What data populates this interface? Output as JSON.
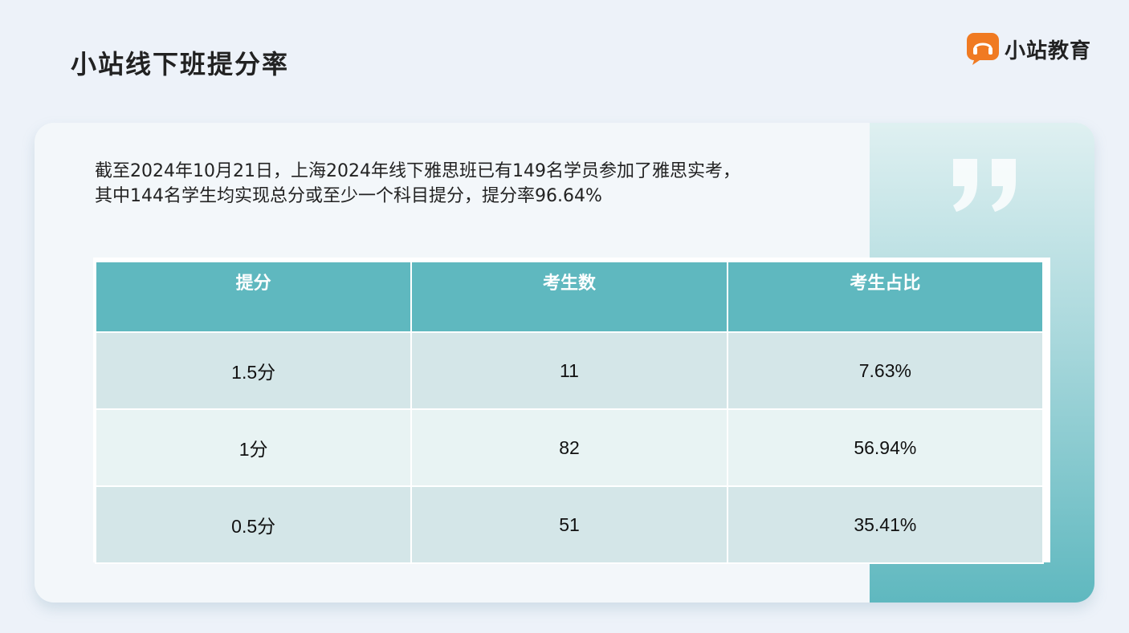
{
  "title": "小站线下班提分率",
  "brand": {
    "name": "小站教育",
    "icon": "chat-headset-icon",
    "color": "#f07a22"
  },
  "intro": {
    "line1": "截至2024年10月21日，上海2024年线下雅思班已有149名学员参加了雅思实考，",
    "line2": "其中144名学生均实现总分或至少一个科目提分，提分率96.64%"
  },
  "table": {
    "headers": [
      "提分",
      "考生数",
      "考生占比"
    ],
    "rows": [
      [
        "1.5分",
        "11",
        "7.63%"
      ],
      [
        "1分",
        "82",
        "56.94%"
      ],
      [
        "0.5分",
        "51",
        "35.41%"
      ]
    ]
  },
  "colors": {
    "header_bg": "#5fb8bf",
    "row_dark": "#d4e6e8",
    "row_light": "#e8f3f3"
  }
}
